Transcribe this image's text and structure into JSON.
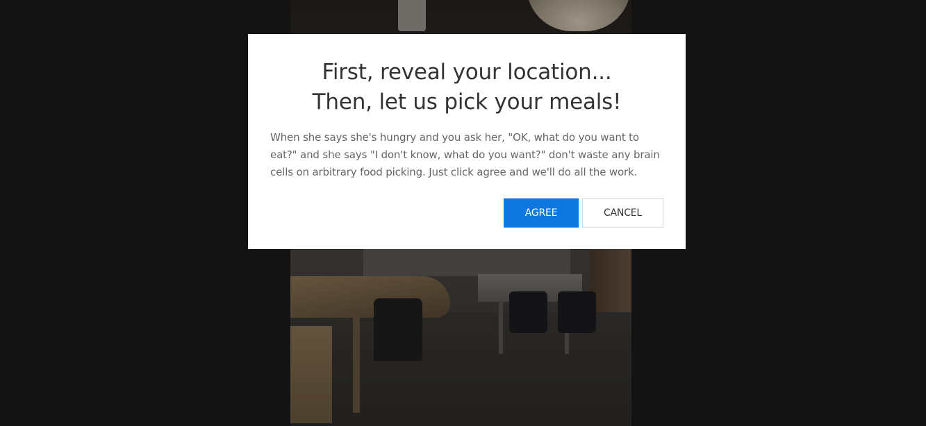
{
  "modal": {
    "title_line1": "First, reveal your location...",
    "title_line2": "Then, let us pick your meals!",
    "body": "When she says she's hungry and you ask her, \"OK, what do you want to eat?\" and she says \"I don't know, what do you want?\" don't waste any brain cells on arbitrary food picking. Just click agree and we'll do all the work.",
    "agree_label": "AGREE",
    "cancel_label": "CANCEL"
  },
  "colors": {
    "backdrop": "#131313",
    "modal_bg": "#ffffff",
    "title_text": "#333333",
    "body_text": "#666666",
    "agree_bg": "#0f78e0",
    "agree_text": "#ffffff",
    "cancel_border": "#d6d6d6"
  }
}
